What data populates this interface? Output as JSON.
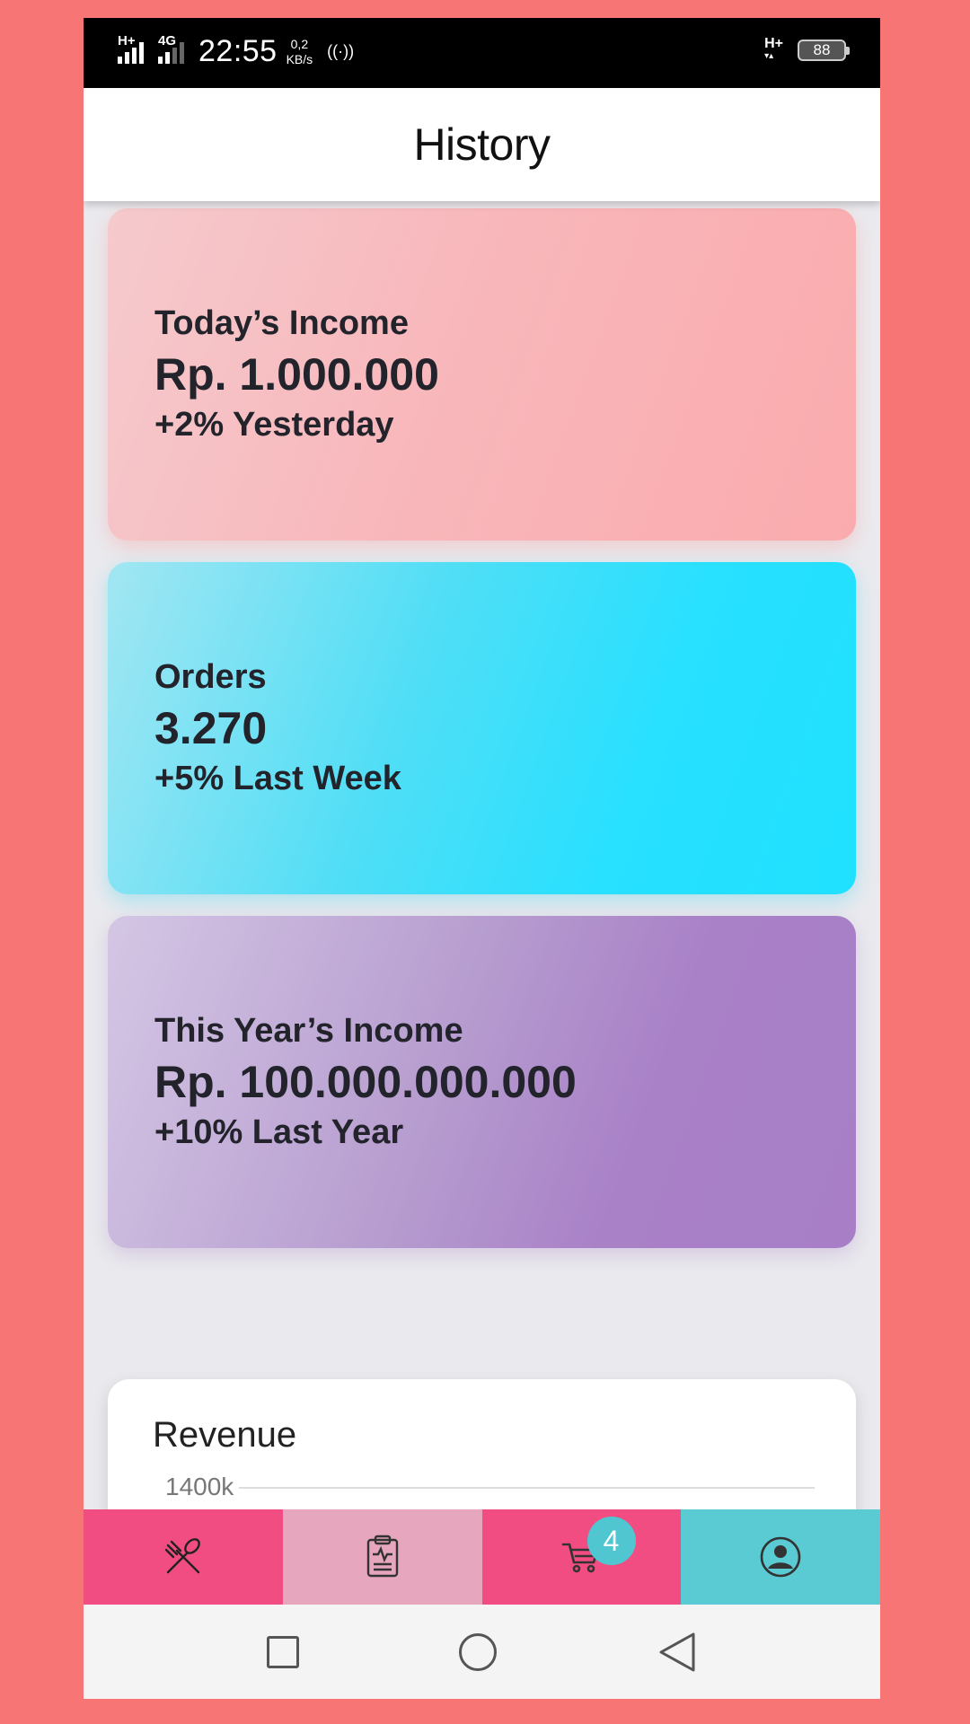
{
  "status_bar": {
    "network_1": "H+",
    "network_2": "4G",
    "time": "22:55",
    "data_rate_value": "0,2",
    "data_rate_unit": "KB/s",
    "network_right": "H+",
    "battery": "88"
  },
  "header": {
    "title": "History"
  },
  "cards": {
    "income": {
      "title": "Today’s Income",
      "value": "Rp. 1.000.000",
      "change": "+2% Yesterday",
      "color": "#f8b7bb"
    },
    "orders": {
      "title": "Orders",
      "value": "3.270",
      "change": "+5% Last Week",
      "color": "#28e0ff"
    },
    "year": {
      "title": "This Year’s Income",
      "value": "Rp. 100.000.000.000",
      "change": "+10% Last Year",
      "color": "#a981c7"
    }
  },
  "revenue": {
    "title": "Revenue",
    "tick": "1400k"
  },
  "tabbar": {
    "tabs": [
      {
        "icon": "fork-spoon-icon",
        "color": "#f24d82"
      },
      {
        "icon": "clipboard-icon",
        "color": "#e6a6bd"
      },
      {
        "icon": "cart-icon",
        "color": "#f24d82"
      },
      {
        "icon": "user-icon",
        "color": "#5bcbd3"
      }
    ],
    "cart_badge": "4"
  },
  "navbar": {
    "buttons": [
      "recents-icon",
      "home-icon",
      "back-icon"
    ]
  }
}
